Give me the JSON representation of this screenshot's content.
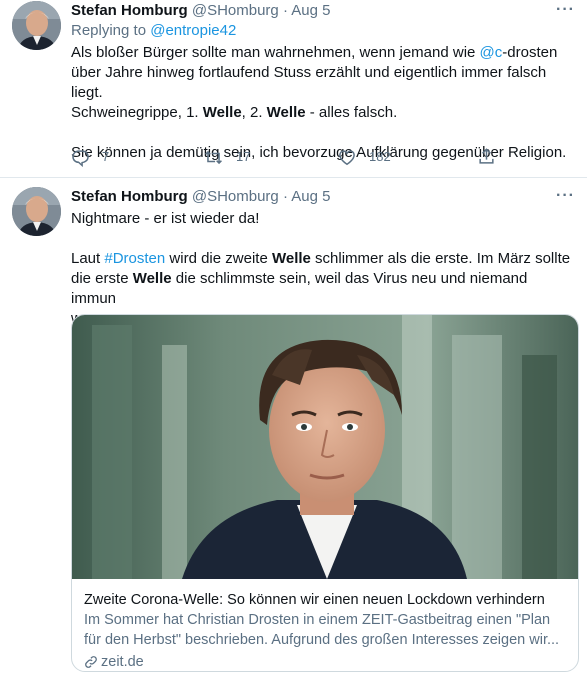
{
  "tweet1": {
    "author_name": "Stefan Homburg",
    "author_handle": "@SHomburg",
    "separator": "·",
    "time": "Aug 5",
    "more_icon": "···",
    "replying_prefix": "Replying to ",
    "replying_handle": "@entropie42",
    "text": {
      "l1_a": "Als bloßer Bürger sollte man wahrnehmen, wenn jemand wie ",
      "l1_link": "@c",
      "l1_b": "-drosten",
      "l2": "über Jahre hinweg fortlaufend Stuss erzählt und eigentlich immer falsch liegt.",
      "l3_a": "Schweinegrippe, 1. ",
      "l3_b1": "Welle",
      "l3_c": ", 2. ",
      "l3_b2": "Welle",
      "l3_d": " - alles falsch.",
      "l4": "Sie können ja demütig sein, ich bevorzuge Aufklärung gegenüber Religion."
    },
    "reply_count": "7",
    "retweet_count": "17",
    "like_count": "182"
  },
  "tweet2": {
    "author_name": "Stefan Homburg",
    "author_handle": "@SHomburg",
    "separator": "·",
    "time": "Aug 5",
    "more_icon": "···",
    "text": {
      "l1": "Nightmare - er ist wieder da!",
      "l2_a": "Laut ",
      "l2_link": "#Drosten",
      "l2_b": " wird die zweite ",
      "l2_bold": "Welle",
      "l2_c": " schlimmer als die erste. Im März sollte",
      "l3_a": "die erste ",
      "l3_bold": "Welle",
      "l3_b": " die schlimmste sein, weil das Virus neu und niemand immun",
      "l4": "war."
    },
    "card": {
      "title": "Zweite Corona-Welle: So können wir einen neuen Lockdown verhindern",
      "desc_l1": "Im Sommer hat Christian Drosten in einem ZEIT-Gastbeitrag einen \"Plan",
      "desc_l2": "für den Herbst\" beschrieben. Aufgrund des großen Interesses zeigen wir...",
      "domain": "zeit.de"
    }
  },
  "colors": {
    "link": "#1b95e0",
    "secondary_text": "#5b7083",
    "border": "#e1e8ed"
  }
}
